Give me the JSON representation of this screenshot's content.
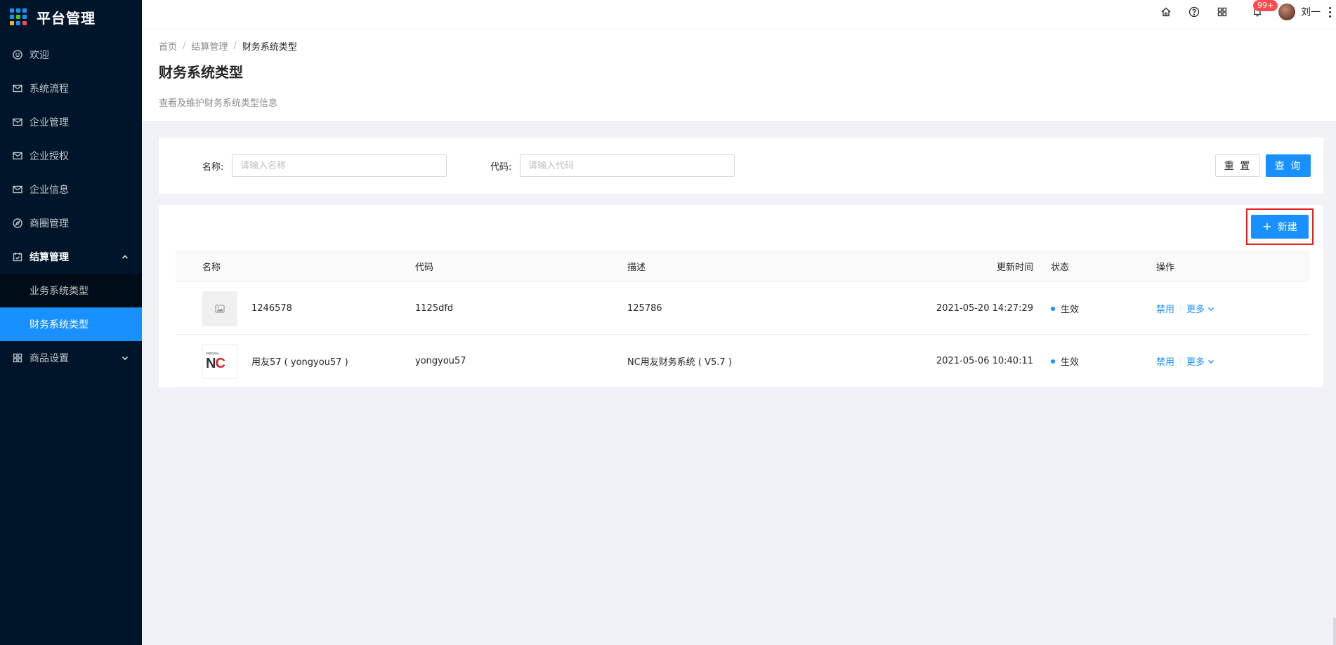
{
  "app": {
    "title": "平台管理"
  },
  "brand_colors": [
    "#1890ff",
    "#52c41a",
    "#faad14",
    "#ff4d4f"
  ],
  "sidebar": {
    "items": [
      {
        "label": "欢迎",
        "icon": "smile-icon"
      },
      {
        "label": "系统流程",
        "icon": "mail-icon"
      },
      {
        "label": "企业管理",
        "icon": "mail-icon"
      },
      {
        "label": "企业授权",
        "icon": "mail-icon"
      },
      {
        "label": "企业信息",
        "icon": "mail-icon"
      },
      {
        "label": "商圈管理",
        "icon": "compass-icon"
      }
    ],
    "settlement": {
      "label": "结算管理",
      "icon": "calendar-icon",
      "children": [
        {
          "label": "业务系统类型"
        },
        {
          "label": "财务系统类型"
        }
      ]
    },
    "product_settings": {
      "label": "商品设置",
      "icon": "appstore-icon"
    }
  },
  "header": {
    "badge": "99+",
    "username": "刘一"
  },
  "breadcrumb": {
    "home": "首页",
    "parent": "结算管理",
    "current": "财务系统类型"
  },
  "page": {
    "title": "财务系统类型",
    "description": "查看及维护财务系统类型信息"
  },
  "search": {
    "name_label": "名称:",
    "name_placeholder": "请输入名称",
    "code_label": "代码:",
    "code_placeholder": "请输入代码",
    "reset_label": "重 置",
    "query_label": "查 询"
  },
  "table": {
    "new_button": "新建",
    "columns": {
      "name": "名称",
      "code": "代码",
      "desc": "描述",
      "updated": "更新时间",
      "status": "状态",
      "ops": "操作"
    },
    "rows": [
      {
        "name": "1246578",
        "code": "1125dfd",
        "desc": "125786",
        "updated": "2021-05-20 14:27:29",
        "status": "生效",
        "op_disable": "禁用",
        "op_more": "更多"
      },
      {
        "name": "用友57 ( yongyou57 )",
        "code": "yongyou57",
        "desc": "NC用友财务系统 ( V5.7 )",
        "updated": "2021-05-06 10:40:11",
        "status": "生效",
        "op_disable": "禁用",
        "op_more": "更多",
        "logo_small": "yonyou",
        "logo_n": "N",
        "logo_c": "C"
      }
    ]
  }
}
